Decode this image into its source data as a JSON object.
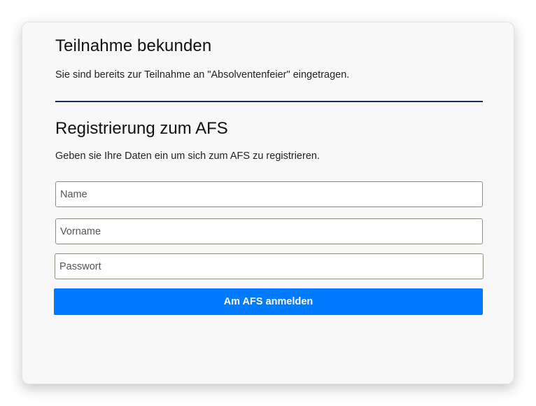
{
  "participation": {
    "title": "Teilnahme bekunden",
    "message": "Sie sind bereits zur Teilnahme an \"Absolventenfeier\" eingetragen."
  },
  "registration": {
    "title": "Registrierung zum AFS",
    "description": "Geben sie Ihre Daten ein um sich zum AFS zu registrieren.",
    "fields": {
      "name": {
        "placeholder": "Name",
        "value": ""
      },
      "vorname": {
        "placeholder": "Vorname",
        "value": ""
      },
      "passwort": {
        "placeholder": "Passwort",
        "value": ""
      }
    },
    "submit_label": "Am AFS anmelden"
  },
  "colors": {
    "button": "#007bff",
    "divider": "#1f2b57",
    "card_background": "#f9f8f9"
  }
}
